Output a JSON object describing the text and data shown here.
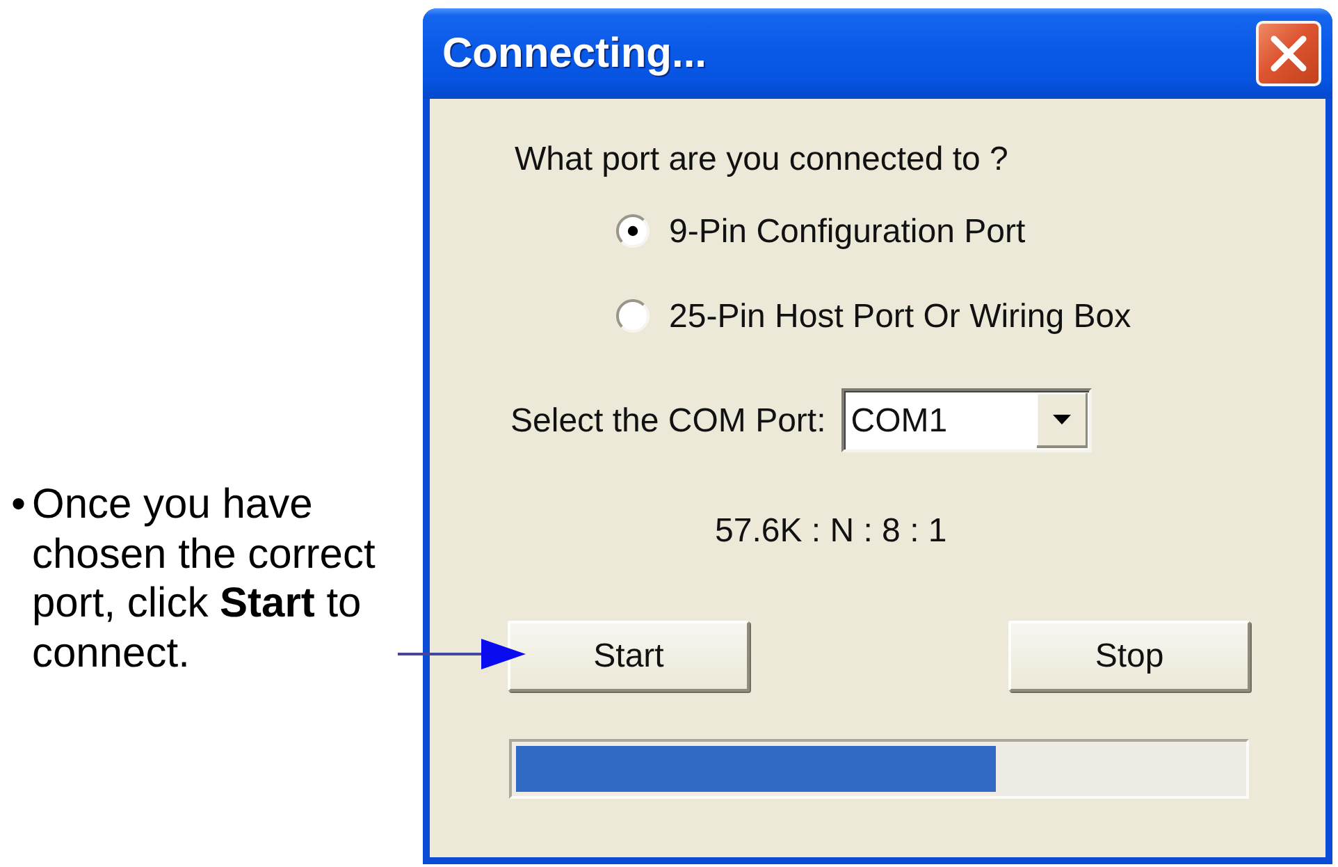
{
  "annotation": {
    "bullet": "•",
    "text": "Once you have chosen the correct port, click **Start** to connect."
  },
  "window": {
    "title": "Connecting..."
  },
  "question": "What port are you connected to ?",
  "ports": [
    {
      "label": "9-Pin Configuration Port",
      "selected": true
    },
    {
      "label": "25-Pin Host Port Or Wiring Box",
      "selected": false
    }
  ],
  "com_port": {
    "label": "Select the COM Port:",
    "value": "COM1"
  },
  "line_settings": "57.6K : N : 8 : 1",
  "buttons": [
    "Start",
    "Stop"
  ],
  "progress": {
    "level": 0.66
  }
}
